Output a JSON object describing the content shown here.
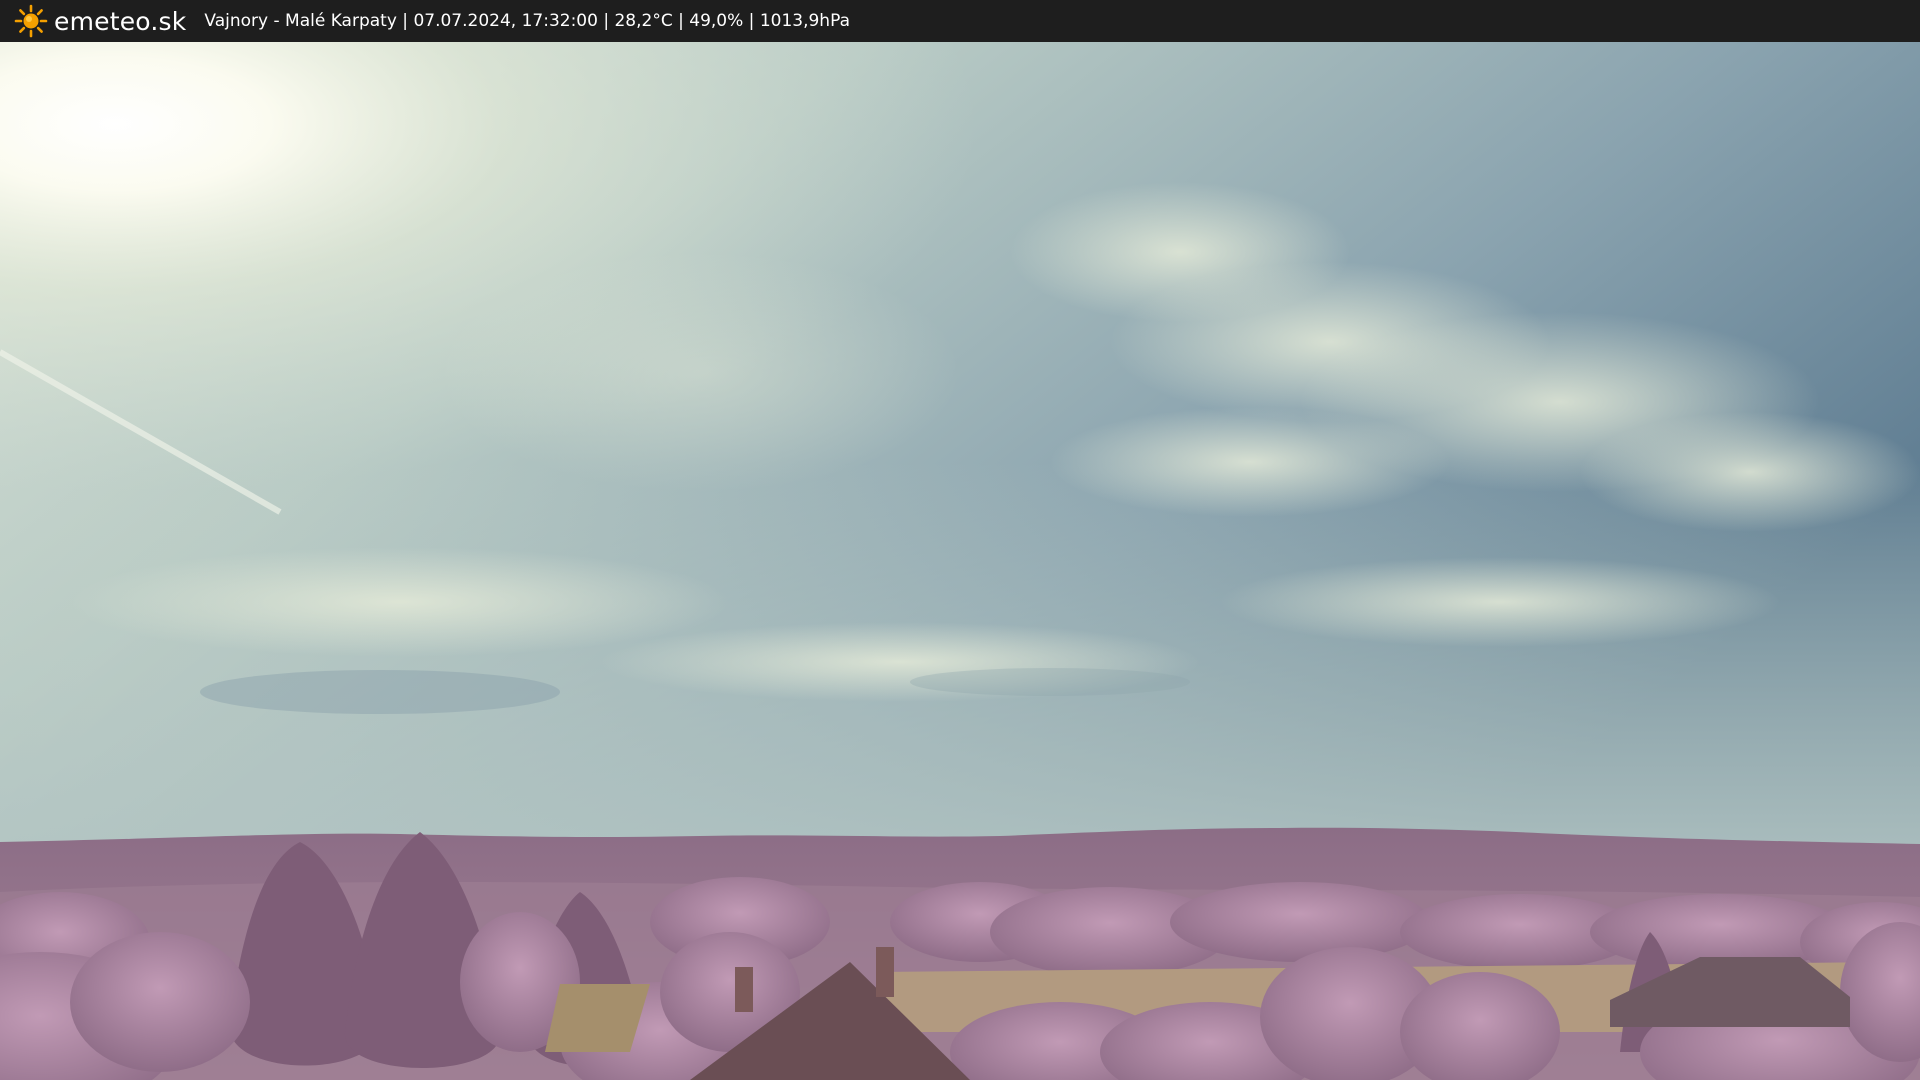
{
  "header": {
    "logo_icon": "sun-icon",
    "brand": "emeteo.sk",
    "location": "Vajnory - Malé Karpaty",
    "separator": " | ",
    "datetime": "07.07.2024, 17:32:00",
    "temperature": "28,2°C",
    "humidity": "49,0%",
    "pressure": "1013,9hPa"
  },
  "colors": {
    "bar_background": "#1e1e1e",
    "sun_orange": "#f5a000",
    "sky_blue": "#6f8c9d",
    "sky_haze": "#c8d6cb",
    "foliage_pink": "#a27f99",
    "field_tan": "#b29a80"
  }
}
